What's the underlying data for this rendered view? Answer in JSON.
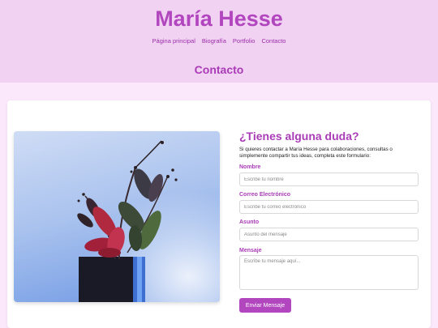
{
  "header": {
    "site_title": "María Hesse",
    "nav": [
      {
        "label": "Página principal"
      },
      {
        "label": "Biografía"
      },
      {
        "label": "Portfolio"
      },
      {
        "label": "Contacto"
      }
    ],
    "page_heading": "Contacto"
  },
  "form": {
    "title": "¿Tienes alguna duda?",
    "intro": "Si quieres contactar a María Hesse para colaboraciones, consultas o simplemente compartir tus ideas, completa este formulario:",
    "name_label": "Nombre",
    "name_placeholder": "Escribe tu nombre",
    "email_label": "Correo Electrónico",
    "email_placeholder": "Escribe tu correo electrónico",
    "subject_label": "Asunto",
    "subject_placeholder": "Asunto del mensaje",
    "message_label": "Mensaje",
    "message_placeholder": "Escribe tu mensaje aquí...",
    "submit_label": "Enviar Mensaje"
  },
  "colors": {
    "accent": "#b146be",
    "header_bg": "#f1d2f3",
    "page_bg": "#fbe9fb"
  }
}
